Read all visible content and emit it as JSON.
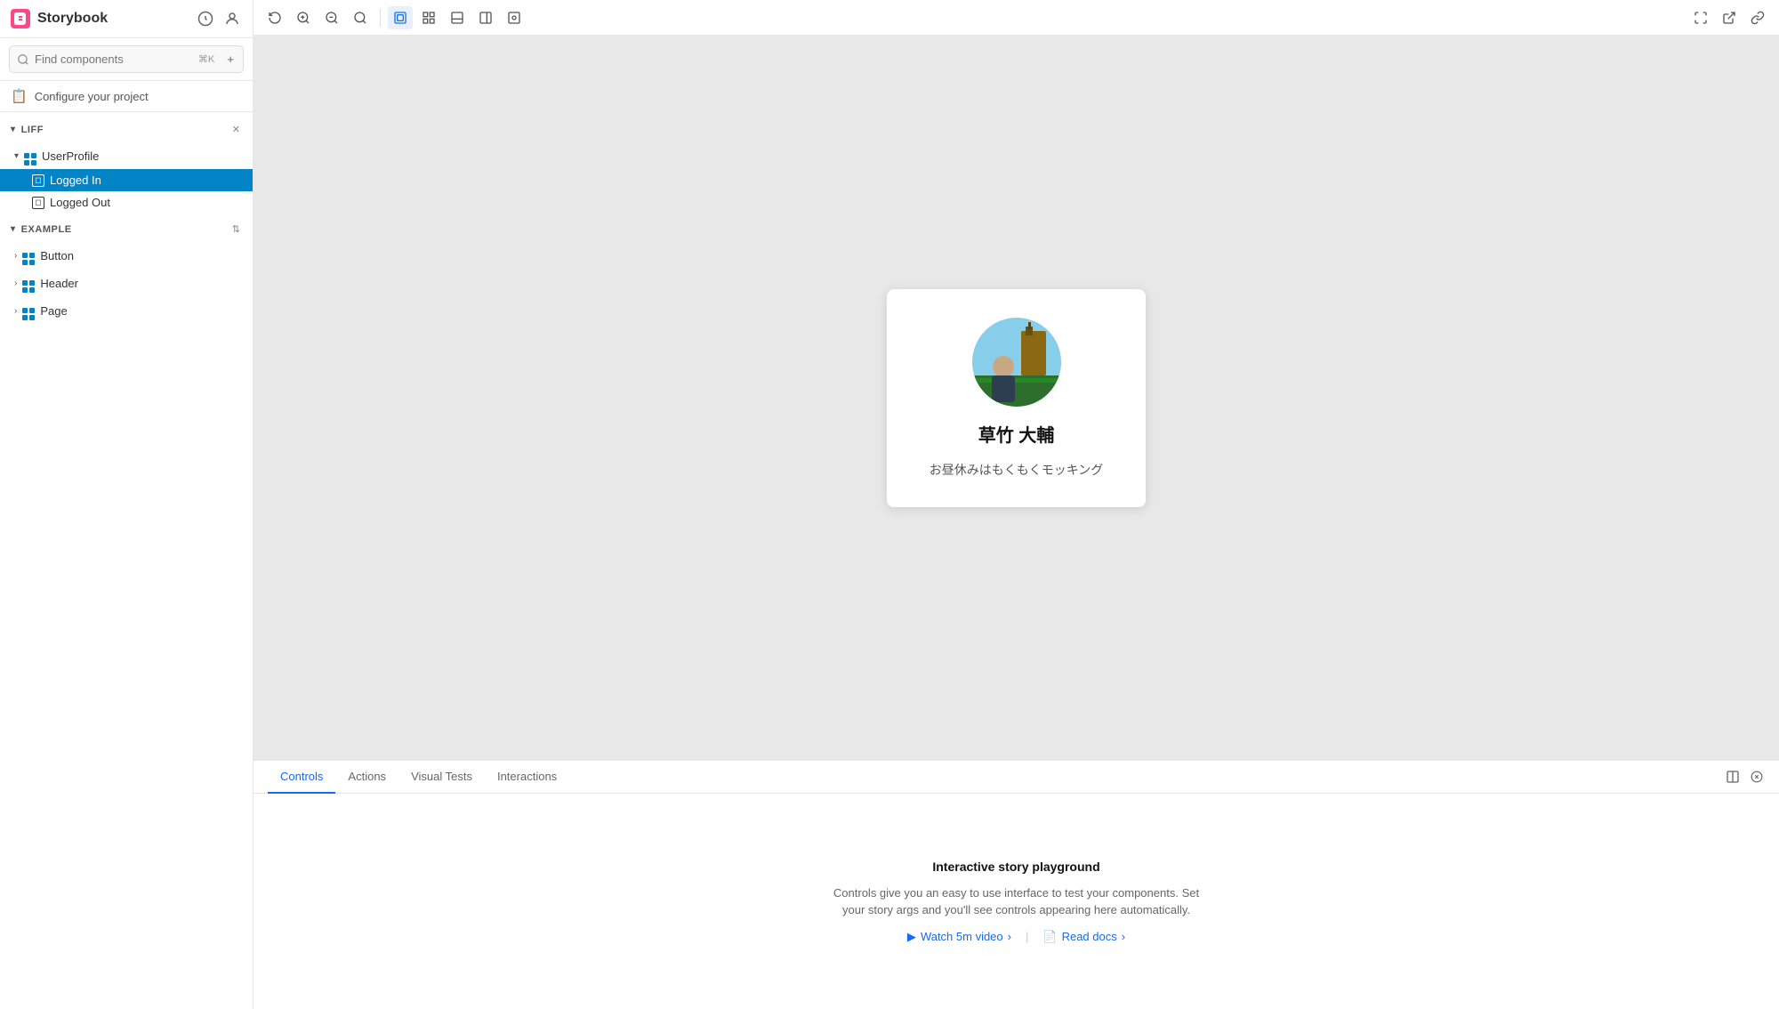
{
  "sidebar": {
    "logo_text": "Storybook",
    "search_placeholder": "Find components",
    "search_shortcut": "⌘K",
    "add_button_label": "+",
    "configure_label": "Configure your project",
    "sections": [
      {
        "id": "liff",
        "title": "LIFF",
        "expanded": true,
        "groups": [
          {
            "id": "user-profile",
            "label": "UserProfile",
            "expanded": true,
            "items": [
              {
                "id": "logged-in",
                "label": "Logged In",
                "active": true
              },
              {
                "id": "logged-out",
                "label": "Logged Out",
                "active": false
              }
            ]
          }
        ]
      },
      {
        "id": "example",
        "title": "EXAMPLE",
        "expanded": true,
        "groups": [
          {
            "id": "button",
            "label": "Button",
            "expanded": false,
            "items": []
          },
          {
            "id": "header",
            "label": "Header",
            "expanded": false,
            "items": []
          },
          {
            "id": "page",
            "label": "Page",
            "expanded": false,
            "items": []
          }
        ]
      }
    ]
  },
  "toolbar": {
    "buttons": [
      {
        "id": "reset-zoom",
        "icon": "↺",
        "label": "Reset zoom"
      },
      {
        "id": "zoom-in",
        "icon": "＋",
        "label": "Zoom in"
      },
      {
        "id": "zoom-out",
        "icon": "－",
        "label": "Zoom out"
      },
      {
        "id": "search",
        "icon": "⌕",
        "label": "Search"
      }
    ],
    "view_buttons": [
      {
        "id": "single-story",
        "icon": "▣",
        "label": "Single story",
        "active": true
      },
      {
        "id": "grid",
        "icon": "⊞",
        "label": "Grid"
      },
      {
        "id": "panel",
        "icon": "▤",
        "label": "Panel"
      },
      {
        "id": "side-panel",
        "icon": "▥",
        "label": "Side panel"
      },
      {
        "id": "full",
        "icon": "⊡",
        "label": "Full"
      }
    ],
    "right_buttons": [
      {
        "id": "expand",
        "icon": "⛶",
        "label": "Expand"
      },
      {
        "id": "external",
        "icon": "↗",
        "label": "Open in new tab"
      },
      {
        "id": "copy-link",
        "icon": "🔗",
        "label": "Copy link"
      }
    ]
  },
  "preview": {
    "profile": {
      "name": "草竹 大輔",
      "status": "お昼休みはもくもくモッキング"
    }
  },
  "bottom_panel": {
    "tabs": [
      {
        "id": "controls",
        "label": "Controls",
        "active": true
      },
      {
        "id": "actions",
        "label": "Actions",
        "active": false
      },
      {
        "id": "visual-tests",
        "label": "Visual Tests",
        "active": false
      },
      {
        "id": "interactions",
        "label": "Interactions",
        "active": false
      }
    ],
    "content": {
      "title": "Interactive story playground",
      "description": "Controls give you an easy to use interface to test your components. Set your story args and you'll see controls appearing here automatically.",
      "links": [
        {
          "id": "watch-video",
          "label": "Watch 5m video",
          "icon": "▶"
        },
        {
          "id": "read-docs",
          "label": "Read docs",
          "icon": "📄"
        }
      ]
    }
  }
}
